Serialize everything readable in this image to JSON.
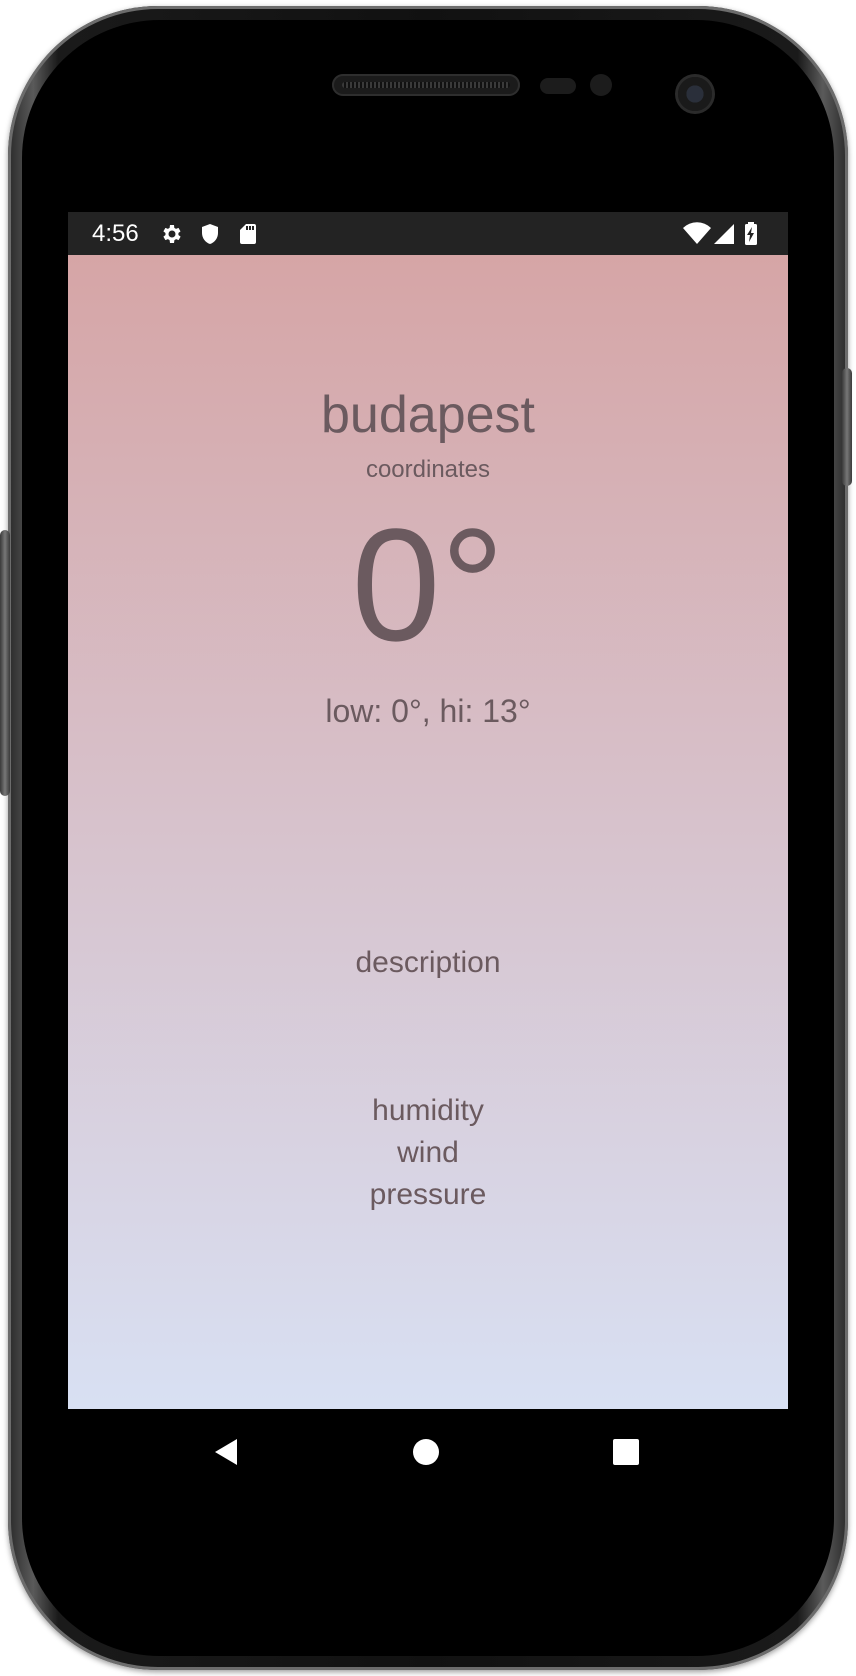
{
  "theme": {
    "gradient_top": "#d6a5a6",
    "gradient_bottom": "#d8e0f3",
    "text_color": "#6b5a5f"
  },
  "status_bar": {
    "time": "4:56",
    "left_icons": [
      "settings-icon",
      "shield-icon",
      "sd-card-icon"
    ],
    "right_icons": [
      "wifi-icon",
      "cell-signal-icon",
      "battery-charging-icon"
    ]
  },
  "weather": {
    "city": "budapest",
    "coordinates": "coordinates",
    "temperature": "0°",
    "low_hi": "low: 0°, hi: 13°",
    "description": "description",
    "humidity": "humidity",
    "wind": "wind",
    "pressure": "pressure"
  },
  "nav_bar": {
    "buttons": [
      "back-icon",
      "home-icon",
      "recents-icon"
    ]
  }
}
